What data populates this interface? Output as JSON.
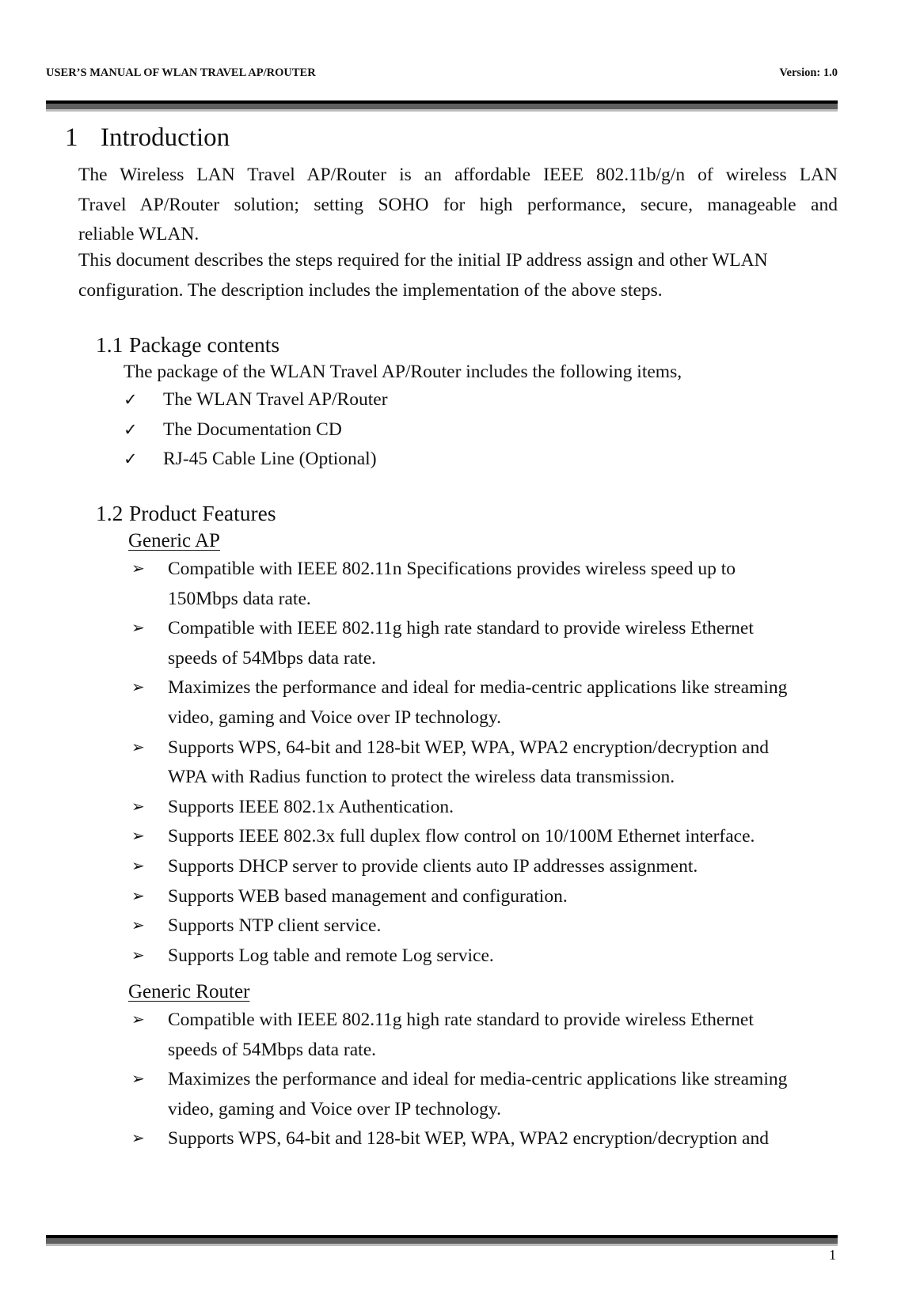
{
  "header": {
    "left": "USER’S MANUAL OF WLAN TRAVEL AP/ROUTER",
    "right": "Version: 1.0"
  },
  "chapter": {
    "number": "1",
    "title": "Introduction"
  },
  "intro_paragraph": {
    "lines": [
      "The Wireless LAN Travel AP/Router is an affordable IEEE 802.11b/g/n of wireless LAN",
      "Travel AP/Router solution; setting SOHO for high performance, secure, manageable and",
      "reliable WLAN."
    ]
  },
  "description_paragraph": {
    "lines": [
      "This document describes the steps required for the initial IP address assign and other WLAN",
      "configuration. The description includes the implementation of the above steps."
    ]
  },
  "section_1_1": {
    "number": "1.1",
    "title": "Package contents",
    "intro": "The package of the WLAN Travel AP/Router includes the following items,",
    "bullet_icon": "checkmark",
    "items": [
      "The WLAN Travel AP/Router",
      "The Documentation CD",
      "RJ-45 Cable Line (Optional)"
    ]
  },
  "section_1_2": {
    "number": "1.2",
    "title": "Product Features",
    "bullet_icon": "arrowhead",
    "generic_ap": {
      "title": "Generic AP",
      "items": [
        [
          "Compatible with IEEE 802.11n Specifications provides wireless speed up to",
          "150Mbps data rate."
        ],
        [
          "Compatible with IEEE 802.11g high rate standard to provide wireless Ethernet",
          "speeds of 54Mbps data rate."
        ],
        [
          "Maximizes the performance and ideal for media-centric applications like streaming",
          "video, gaming and Voice over IP technology."
        ],
        [
          "Supports WPS, 64-bit and 128-bit WEP, WPA, WPA2 encryption/decryption and",
          "WPA with Radius function to protect the wireless data transmission."
        ],
        [
          "Supports IEEE 802.1x Authentication."
        ],
        [
          "Supports IEEE 802.3x full duplex flow control on 10/100M Ethernet interface."
        ],
        [
          "Supports DHCP server to provide clients auto IP addresses assignment."
        ],
        [
          "Supports WEB based management and configuration."
        ],
        [
          "Supports NTP client service."
        ],
        [
          "Supports Log table and remote Log service."
        ]
      ]
    },
    "generic_router": {
      "title": "Generic Router",
      "items": [
        [
          "Compatible with IEEE 802.11g high rate standard to provide wireless Ethernet",
          "speeds of 54Mbps data rate."
        ],
        [
          "Maximizes the performance and ideal for media-centric applications like streaming",
          "video, gaming and Voice over IP technology."
        ],
        [
          "Supports WPS, 64-bit and 128-bit WEP, WPA, WPA2 encryption/decryption and"
        ]
      ]
    }
  },
  "footer": {
    "page_number": "1"
  }
}
